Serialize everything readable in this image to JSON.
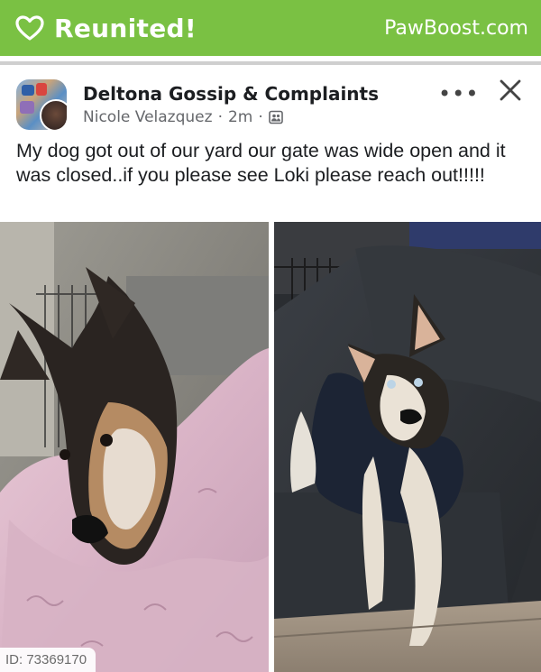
{
  "banner": {
    "title": "Reunited!",
    "brand": "PawBoost.com",
    "color": "#7ac143",
    "icon": "heart-outline-icon"
  },
  "post": {
    "group_name": "Deltona Gossip & Complaints",
    "author": "Nicole Velazquez",
    "time": "2m",
    "separator": "·",
    "privacy_icon": "group-privacy-icon",
    "more_icon": "ellipsis-icon",
    "close_icon": "close-icon",
    "text": "My dog got out of our yard our gate was wide open and it was closed..if you please see Loki please reach out!!!!!"
  },
  "photos": [
    {
      "subject": "husky dog lying on pink blanket"
    },
    {
      "subject": "husky dog sitting on gray couch"
    }
  ],
  "badge": {
    "id_text": "ID: 73369170"
  }
}
